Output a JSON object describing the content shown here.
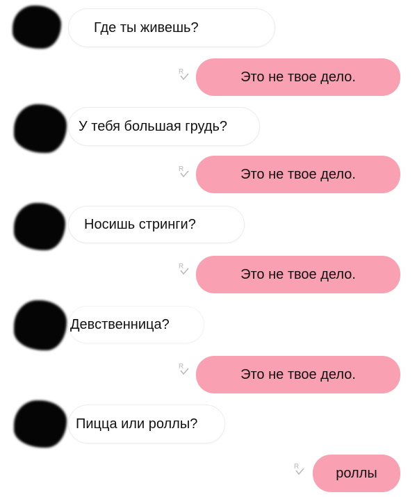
{
  "colors": {
    "outgoing_bubble": "#f9a0b2",
    "incoming_bubble": "#ffffff",
    "avatar": "#050505",
    "read_mark": "#b8b8b8"
  },
  "messages": [
    {
      "direction": "incoming",
      "text": "Где ты живешь?"
    },
    {
      "direction": "outgoing",
      "text": "Это не твое дело.",
      "status_icon": "read-receipt-icon"
    },
    {
      "direction": "incoming",
      "text": "У тебя большая грудь?"
    },
    {
      "direction": "outgoing",
      "text": "Это не твое дело.",
      "status_icon": "read-receipt-icon"
    },
    {
      "direction": "incoming",
      "text": "Носишь стринги?"
    },
    {
      "direction": "outgoing",
      "text": "Это не твое дело.",
      "status_icon": "read-receipt-icon"
    },
    {
      "direction": "incoming",
      "text": "Девственница?"
    },
    {
      "direction": "outgoing",
      "text": "Это не твое дело.",
      "status_icon": "read-receipt-icon"
    },
    {
      "direction": "incoming",
      "text": "Пицца или роллы?"
    },
    {
      "direction": "outgoing",
      "text": "роллы",
      "status_icon": "read-receipt-icon"
    }
  ]
}
